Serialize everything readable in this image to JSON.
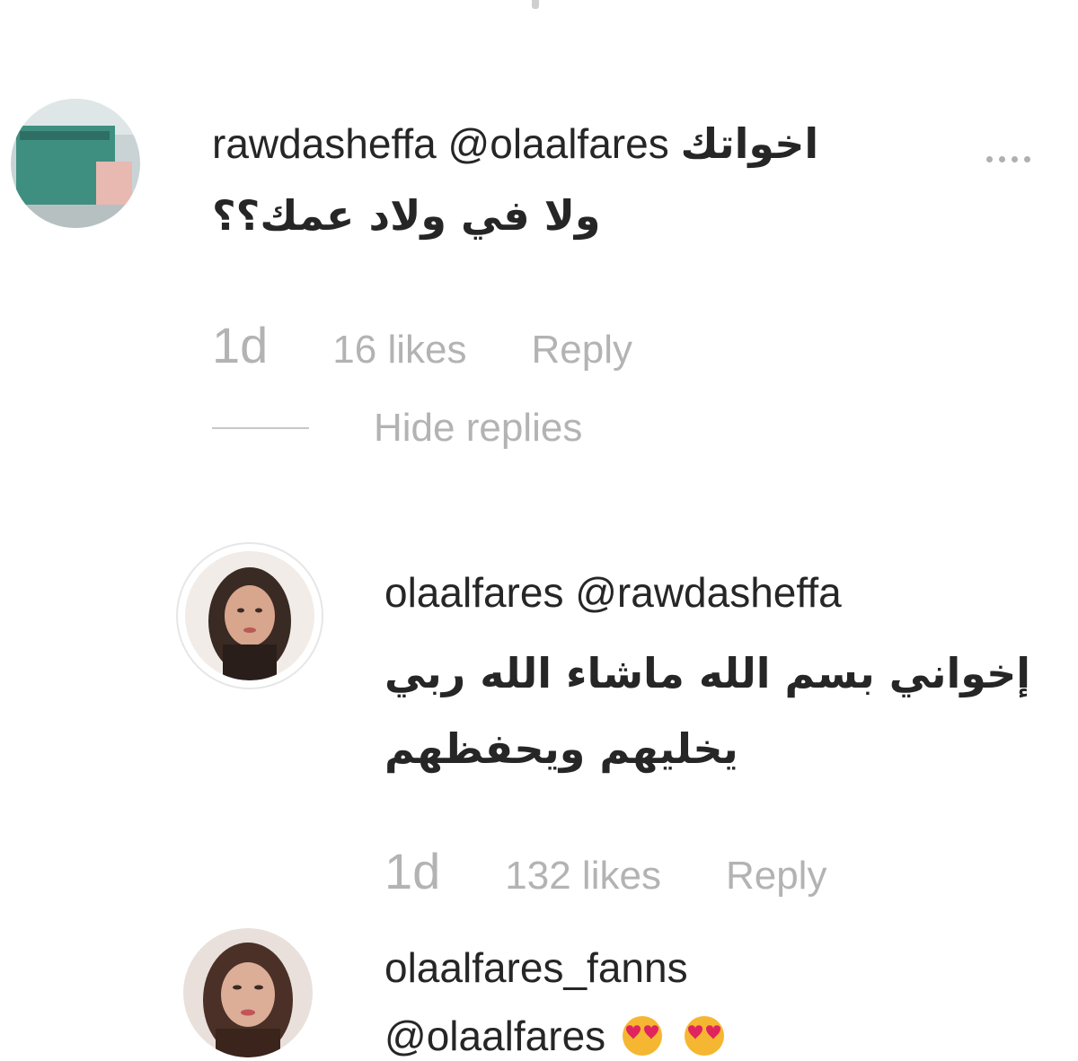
{
  "comments": [
    {
      "username": "rawdasheffa",
      "mention": "@olaalfares",
      "text_line1": "اخواتك",
      "text_line2": "ولا في ولاد عمك؟؟",
      "time": "1d",
      "likes": "16 likes",
      "reply_label": "Reply",
      "hide_replies_label": "Hide replies"
    },
    {
      "username": "olaalfares",
      "mention": "@rawdasheffa",
      "text_line1": "إخواني بسم الله ماشاء الله ربي",
      "text_line2": "يخليهم ويحفظهم",
      "time": "1d",
      "likes": "132 likes",
      "reply_label": "Reply"
    },
    {
      "username": "olaalfares_fanns",
      "mention": "@olaalfares",
      "emoji": "heart-eyes-emoji x2"
    }
  ],
  "colors": {
    "text": "#262626",
    "meta": "#b3b3b3",
    "divider": "#c7c7c7"
  }
}
